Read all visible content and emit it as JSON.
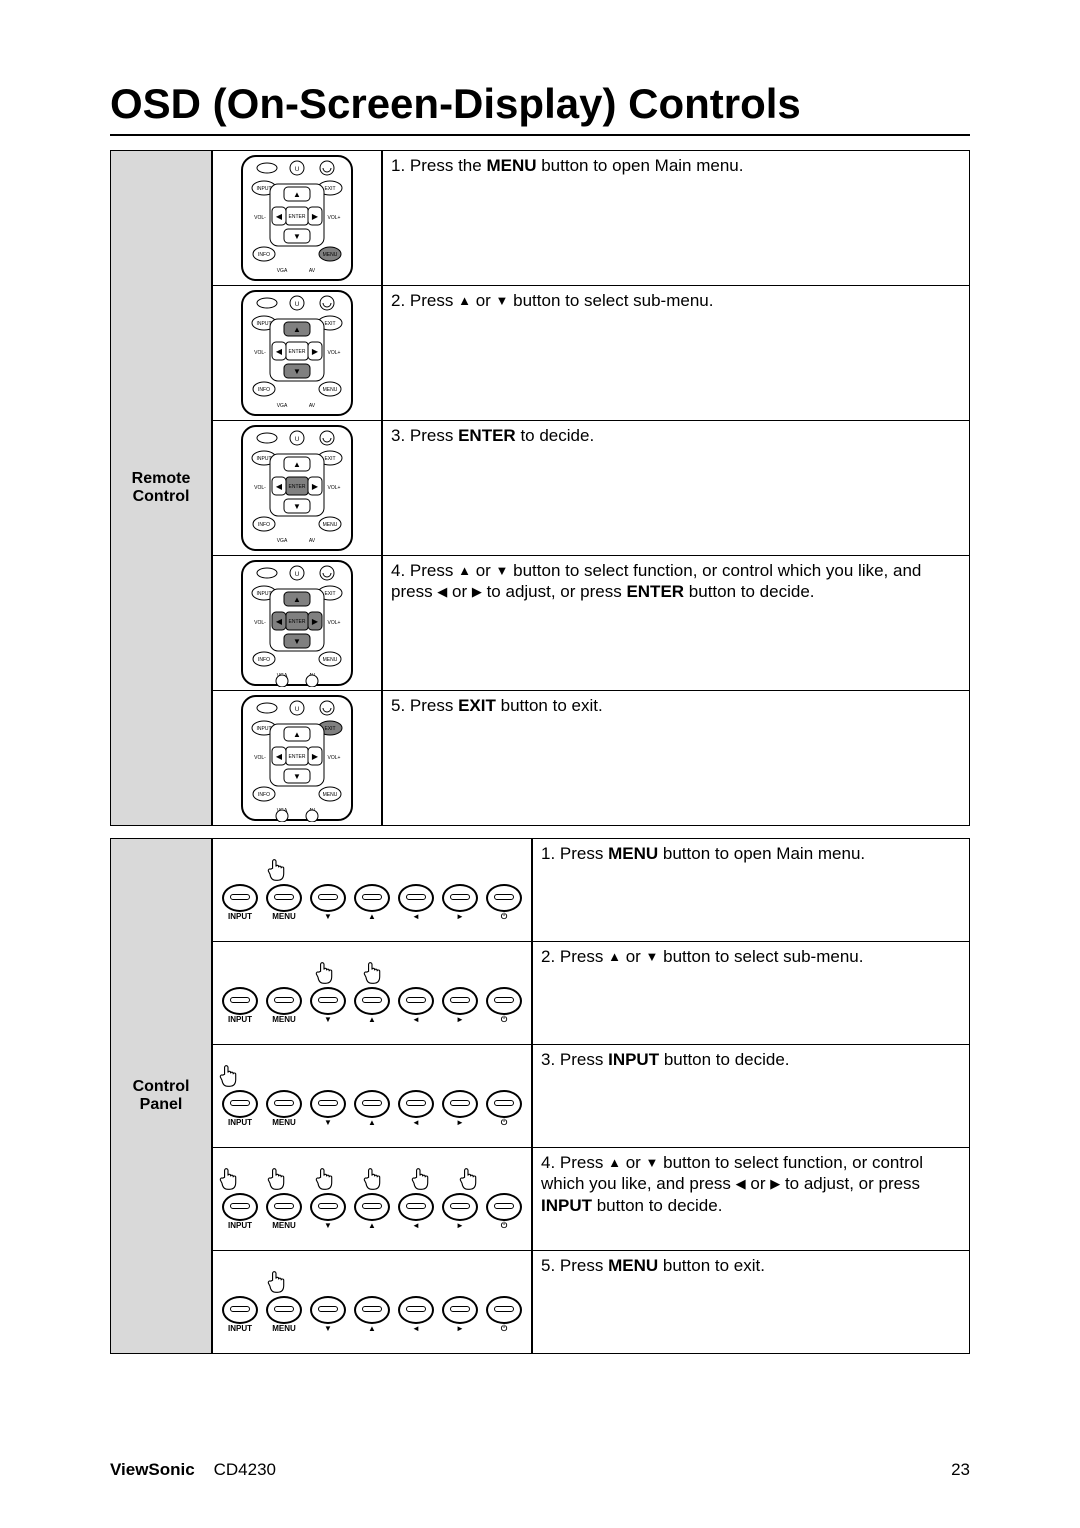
{
  "title": "OSD (On-Screen-Display) Controls",
  "remote": {
    "label": "Remote\nControl",
    "steps": [
      {
        "pre": "1. Press the ",
        "bold": "MENU",
        "post": " button to open Main menu.",
        "highlight": "MENU"
      },
      {
        "pre": "2.  Press ",
        "arrows_ud": true,
        "mid": " button to select sub-menu.",
        "highlight": "UD"
      },
      {
        "pre": "3. Press ",
        "bold": "ENTER",
        "post": " to decide.",
        "highlight": "ENTER"
      },
      {
        "full4": true,
        "a": "4. Press ",
        "b": " button to select function, or control which you like, and press ",
        "c": " to adjust, or press ",
        "bold": "ENTER",
        "d": " button to decide.",
        "highlight": "ALL"
      },
      {
        "pre": "5. Press ",
        "bold": "EXIT",
        "post": " button to exit.",
        "highlight": "EXIT"
      }
    ]
  },
  "panel": {
    "label": "Control\nPanel",
    "buttons": [
      "INPUT",
      "MENU",
      "▼",
      "▲",
      "◄",
      "►",
      "⏻"
    ],
    "steps": [
      {
        "pre": "1. Press ",
        "bold": "MENU",
        "post": " button to open Main menu.",
        "press": [
          "MENU"
        ]
      },
      {
        "pre": "2.  Press ",
        "arrows_ud": true,
        "mid": " button to select sub-menu.",
        "press": [
          "▼",
          "▲"
        ]
      },
      {
        "pre": "3. Press ",
        "bold": "INPUT",
        "post": " button to decide.",
        "press": [
          "INPUT"
        ]
      },
      {
        "full4": true,
        "a": "4. Press ",
        "b": " button to select function, or control which you like, and press ",
        "c": " to adjust, or press ",
        "bold": "INPUT",
        "d": " button to decide.",
        "press": [
          "INPUT",
          "MENU",
          "▼",
          "▲",
          "◄",
          "►"
        ]
      },
      {
        "pre": "5. Press ",
        "bold": "MENU",
        "post": " button to exit.",
        "press": [
          "MENU"
        ]
      }
    ]
  },
  "footer": {
    "brand": "ViewSonic",
    "model": "CD4230",
    "page": "23"
  },
  "glyphs": {
    "up": "▲",
    "down": "▼",
    "left": "◀",
    "right": "▶",
    "power": "⏻"
  }
}
